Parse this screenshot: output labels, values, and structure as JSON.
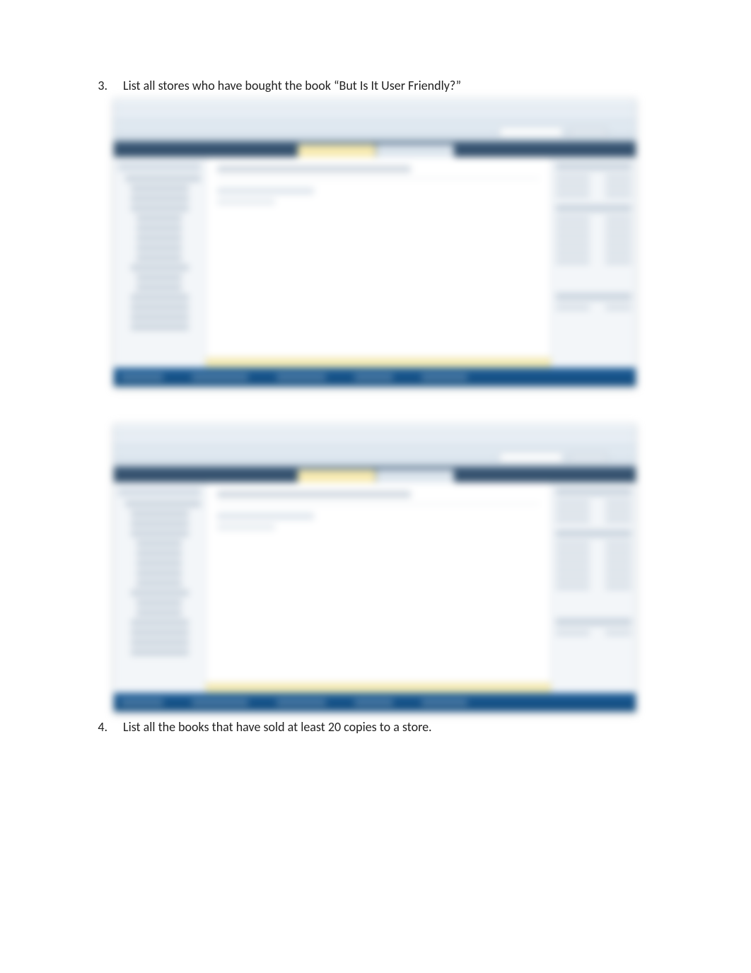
{
  "questions": [
    {
      "number": "3.",
      "text": "List all stores who have bought the book “But Is It User Friendly?”"
    },
    {
      "number": "4.",
      "text": "List all the books that have sold at least 20 copies to a store."
    }
  ]
}
